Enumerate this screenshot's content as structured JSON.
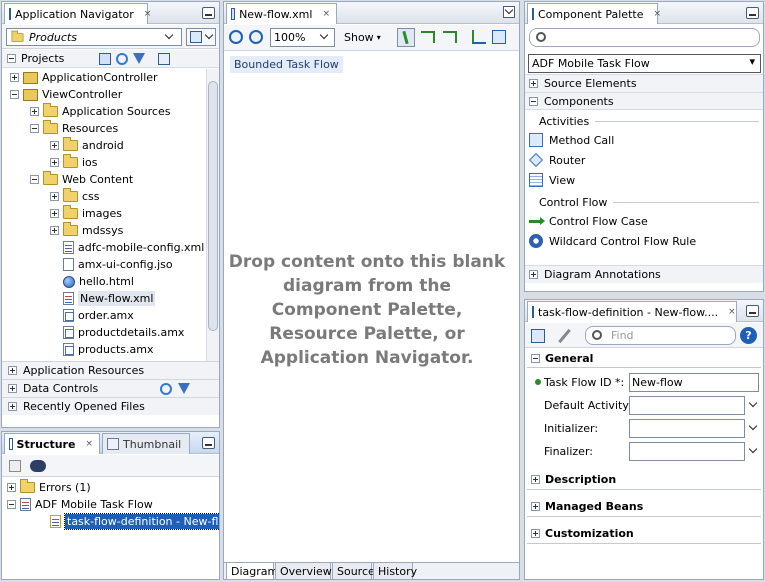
{
  "app_nav": {
    "tab_label": "Application Navigator",
    "project_selector": "Products",
    "projects_label": "Projects",
    "tree": [
      {
        "label": "ApplicationController",
        "depth": 0,
        "exp": "plus",
        "icon": "project"
      },
      {
        "label": "ViewController",
        "depth": 0,
        "exp": "minus",
        "icon": "project"
      },
      {
        "label": "Application Sources",
        "depth": 1,
        "exp": "plus",
        "icon": "folder"
      },
      {
        "label": "Resources",
        "depth": 1,
        "exp": "minus",
        "icon": "folder"
      },
      {
        "label": "android",
        "depth": 2,
        "exp": "plus",
        "icon": "folder"
      },
      {
        "label": "ios",
        "depth": 2,
        "exp": "plus",
        "icon": "folder"
      },
      {
        "label": "Web Content",
        "depth": 1,
        "exp": "minus",
        "icon": "folder"
      },
      {
        "label": "css",
        "depth": 2,
        "exp": "plus",
        "icon": "folder"
      },
      {
        "label": "images",
        "depth": 2,
        "exp": "plus",
        "icon": "folder"
      },
      {
        "label": "mdssys",
        "depth": 2,
        "exp": "plus",
        "icon": "folder"
      },
      {
        "label": "adfc-mobile-config.xml",
        "depth": 2,
        "exp": "",
        "icon": "xml"
      },
      {
        "label": "amx-ui-config.jso",
        "depth": 2,
        "exp": "",
        "icon": "file"
      },
      {
        "label": "hello.html",
        "depth": 2,
        "exp": "",
        "icon": "globe"
      },
      {
        "label": "New-flow.xml",
        "depth": 2,
        "exp": "",
        "icon": "xml",
        "selected": true
      },
      {
        "label": "order.amx",
        "depth": 2,
        "exp": "",
        "icon": "amx"
      },
      {
        "label": "productdetails.amx",
        "depth": 2,
        "exp": "",
        "icon": "amx"
      },
      {
        "label": "products.amx",
        "depth": 2,
        "exp": "",
        "icon": "amx"
      }
    ],
    "sections": [
      "Application Resources",
      "Data Controls",
      "Recently Opened Files"
    ]
  },
  "structure": {
    "tab_label": "Structure",
    "thumbnail_label": "Thumbnail",
    "tree": [
      {
        "label": "Errors (1)",
        "depth": 0,
        "exp": "plus",
        "icon": "folder"
      },
      {
        "label": "ADF Mobile Task Flow",
        "depth": 0,
        "exp": "minus",
        "icon": "xml"
      },
      {
        "label": "task-flow-definition - New-flow",
        "depth": 1,
        "exp": "",
        "icon": "taskflow",
        "selected": true
      }
    ]
  },
  "editor": {
    "tab_label": "New-flow.xml",
    "zoom": "100%",
    "show_label": "Show",
    "breadcrumb": "Bounded Task Flow",
    "placeholder": "Drop content onto this blank diagram from the Component Palette, Resource Palette, or Application Navigator.",
    "bottom_tabs": [
      "Diagram",
      "Overview",
      "Source",
      "History"
    ]
  },
  "palette": {
    "tab_label": "Component Palette",
    "category": "ADF Mobile Task Flow",
    "groups": {
      "source_elements": "Source Elements",
      "components": "Components",
      "activities": "Activities",
      "control_flow": "Control Flow",
      "diagram_annotations": "Diagram Annotations"
    },
    "activities": [
      "Method Call",
      "Router",
      "View"
    ],
    "control_flow_items": [
      "Control Flow Case",
      "Wildcard Control Flow Rule"
    ]
  },
  "properties": {
    "tab_label": "task-flow-definition - New-flow....",
    "find_placeholder": "Find",
    "general_label": "General",
    "fields": [
      {
        "label": "Task Flow ID *:",
        "value": "New-flow"
      },
      {
        "label": "Default Activity:",
        "value": ""
      },
      {
        "label": "Initializer:",
        "value": ""
      },
      {
        "label": "Finalizer:",
        "value": ""
      }
    ],
    "sections": [
      "Description",
      "Managed Beans",
      "Customization"
    ]
  },
  "colors": {
    "accent": "#1f5fb8",
    "selection": "#cfe0f7",
    "placeholder_text": "#7a7a7a"
  }
}
